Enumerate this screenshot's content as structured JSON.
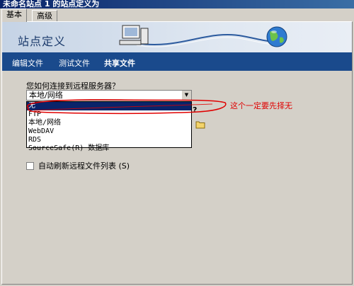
{
  "window": {
    "title": "未命名站点 1 的站点定义为"
  },
  "tabs": [
    {
      "label": "基本"
    },
    {
      "label": "高级"
    }
  ],
  "banner": {
    "title": "站点定义"
  },
  "nav": {
    "items": [
      {
        "label": "编辑文件"
      },
      {
        "label": "测试文件"
      },
      {
        "label": "共享文件"
      }
    ]
  },
  "form": {
    "question": "您如何连接到远程服务器？",
    "select_value": "本地/网络",
    "question_mark": "?",
    "options": [
      {
        "label": "无"
      },
      {
        "label": "FTP"
      },
      {
        "label": "本地/网络"
      },
      {
        "label": "WebDAV"
      },
      {
        "label": "RDS"
      },
      {
        "label": "SourceSafe(R) 数据库"
      }
    ],
    "checkbox_label": "自动刷新远程文件列表 (S)"
  },
  "annotation": {
    "text": "这个一定要先择无",
    "color": "#e00000"
  },
  "colors": {
    "nav_bg": "#1a4a8c",
    "highlight": "#0a246a",
    "titlebar": "#0a246a"
  },
  "icons": [
    "computer-icon",
    "globe-icon",
    "folder-icon",
    "dropdown-arrow-icon"
  ]
}
